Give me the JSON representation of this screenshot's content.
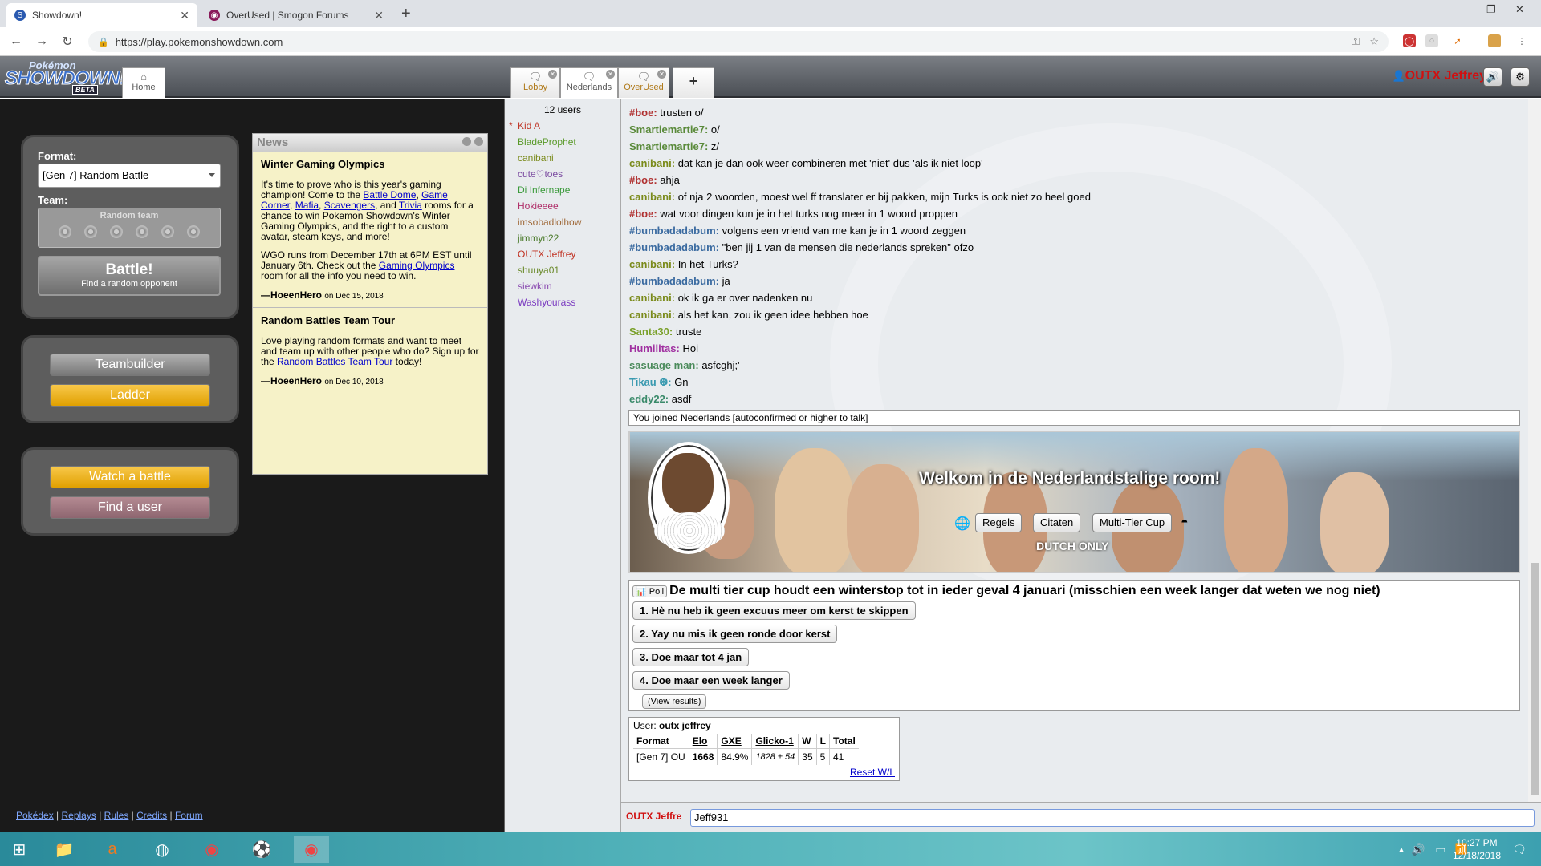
{
  "browser": {
    "tabs": [
      {
        "title": "Showdown!",
        "favicon": "S"
      },
      {
        "title": "OverUsed | Smogon Forums",
        "favicon": "smogon"
      }
    ],
    "url": "https://play.pokemonshowdown.com"
  },
  "ps_header": {
    "logo_top": "Pokémon",
    "logo_main": "SHOWDOWN!",
    "logo_badge": "BETA",
    "home_label": "Home",
    "rooms": [
      {
        "label": "Lobby"
      },
      {
        "label": "Nederlands"
      },
      {
        "label": "OverUsed"
      }
    ],
    "add_label": "+",
    "username": "OUTX Jeffrey"
  },
  "home": {
    "format_label": "Format:",
    "format_value": "[Gen 7] Random Battle",
    "team_label": "Team:",
    "team_value": "Random team",
    "battle_label": "Battle!",
    "battle_sub": "Find a random opponent",
    "teambuilder": "Teambuilder",
    "ladder": "Ladder",
    "watch": "Watch a battle",
    "find_user": "Find a user"
  },
  "news": {
    "header": "News",
    "items": [
      {
        "title": "Winter Gaming Olympics",
        "p1a": "It's time to prove who is this year's gaming champion! Come to the ",
        "links1": [
          "Battle Dome",
          "Game Corner",
          "Mafia",
          "Scavengers",
          "Trivia"
        ],
        "p1b": " rooms for a chance to win Pokemon Showdown's Winter Gaming Olympics, and the right to a custom avatar, steam keys, and more!",
        "p2a": "WGO runs from December 17th at 6PM EST until January 6th. Check out the ",
        "p2link": "Gaming Olympics",
        "p2b": " room for all the info you need to win.",
        "author": "—HoeenHero",
        "date": "on Dec 15, 2018"
      },
      {
        "title": "Random Battles Team Tour",
        "p1a": "Love playing random formats and want to meet and team up with other people who do? Sign up for the ",
        "p1link": "Random Battles Team Tour",
        "p1b": " today!",
        "author": "—HoeenHero",
        "date": "on Dec 10, 2018"
      }
    ]
  },
  "footer_links": [
    "Pokédex",
    "Replays",
    "Rules",
    "Credits",
    "Forum"
  ],
  "userlist": {
    "count": "12 users",
    "users": [
      {
        "sym": "*",
        "name": "Kid A",
        "color": "#c0392b"
      },
      {
        "sym": "",
        "name": "BladeProphet",
        "color": "#5a9a2a"
      },
      {
        "sym": "",
        "name": "canibani",
        "color": "#7a8a1a"
      },
      {
        "sym": "",
        "name": "cute♡toes",
        "color": "#7a4aa0"
      },
      {
        "sym": "",
        "name": "Di Infernape",
        "color": "#3a9a3a"
      },
      {
        "sym": "",
        "name": "Hokieeee",
        "color": "#b0306a"
      },
      {
        "sym": "",
        "name": "imsobadlolhow",
        "color": "#a06a3a"
      },
      {
        "sym": "",
        "name": "jimmyn22",
        "color": "#4a7a2a"
      },
      {
        "sym": "",
        "name": "OUTX Jeffrey",
        "color": "#c03020"
      },
      {
        "sym": "",
        "name": "shuuya01",
        "color": "#6a8a2a"
      },
      {
        "sym": "",
        "name": "siewkim",
        "color": "#8a4ab0"
      },
      {
        "sym": "",
        "name": "Washyourass",
        "color": "#7a3ac0"
      }
    ]
  },
  "chat": {
    "lines": [
      {
        "name": "#boe:",
        "color": "#b03030",
        "text": "trusten o/"
      },
      {
        "name": "Smartiemartie7:",
        "color": "#5a8a3a",
        "text": "o/"
      },
      {
        "name": "Smartiemartie7:",
        "color": "#5a8a3a",
        "text": "z/"
      },
      {
        "name": "canibani:",
        "color": "#7a8a1a",
        "text": "dat kan je dan ook weer combineren met 'niet' dus 'als ik niet loop'"
      },
      {
        "name": "#boe:",
        "color": "#b03030",
        "text": "ahja"
      },
      {
        "name": "canibani:",
        "color": "#7a8a1a",
        "text": "of nja 2 woorden, moest wel ff translater er bij pakken, mijn Turks is ook niet zo heel goed"
      },
      {
        "name": "#boe:",
        "color": "#b03030",
        "text": "wat voor dingen kun je in het turks nog meer in 1 woord proppen"
      },
      {
        "name": "#bumbadadabum:",
        "color": "#3a6aa0",
        "text": "volgens een vriend van me kan je in 1 woord zeggen"
      },
      {
        "name": "#bumbadadabum:",
        "color": "#3a6aa0",
        "text": "\"ben jij 1 van de mensen die nederlands spreken\" ofzo"
      },
      {
        "name": "canibani:",
        "color": "#7a8a1a",
        "text": "In het Turks?"
      },
      {
        "name": "#bumbadadabum:",
        "color": "#3a6aa0",
        "text": "ja"
      },
      {
        "name": "canibani:",
        "color": "#7a8a1a",
        "text": "ok ik ga er over nadenken nu"
      },
      {
        "name": "canibani:",
        "color": "#7a8a1a",
        "text": "als het kan, zou ik geen idee hebben hoe"
      },
      {
        "name": "Santa30:",
        "color": "#7aa02a",
        "text": "truste"
      },
      {
        "name": "Humilitas:",
        "color": "#a030a0",
        "text": "Hoi"
      },
      {
        "name": "sasuage man:",
        "color": "#4a8a5a",
        "text": "asfcghj;'"
      },
      {
        "name": "Tikau ❆:",
        "color": "#3a9ab0",
        "text": "Gn"
      },
      {
        "name": "eddy22:",
        "color": "#3a8a6a",
        "text": "asdf"
      }
    ],
    "joined": "You joined Nederlands [autoconfirmed or higher to talk]",
    "banner_title": "Welkom in de Nederlandstalige room!",
    "banner_buttons": [
      "Regels",
      "Citaten",
      "Multi-Tier Cup"
    ],
    "banner_sub": "DUTCH ONLY",
    "poll": {
      "tag": "Poll",
      "question": "De multi tier cup houdt een winterstop tot in ieder geval 4 januari (misschien een week langer dat weten we nog niet)",
      "options": [
        "1. Hè nu heb ik geen excuus meer om kerst te skippen",
        "2. Yay nu mis ik geen ronde door kerst",
        "3. Doe maar tot 4 jan",
        "4. Doe maar een week langer"
      ],
      "view_results": "(View results)"
    },
    "stats": {
      "user_label": "User:",
      "user": "outx jeffrey",
      "headers": [
        "Format",
        "Elo",
        "GXE",
        "Glicko-1",
        "W",
        "L",
        "Total"
      ],
      "row": [
        "[Gen 7] OU",
        "1668",
        "84.9%",
        "1828 ± 54",
        "35",
        "5",
        "41"
      ],
      "reset": "Reset W/L"
    },
    "input_name": "OUTX Jeffre",
    "input_value": "Jeff931"
  },
  "taskbar": {
    "time": "10:27 PM",
    "date": "12/18/2018"
  }
}
